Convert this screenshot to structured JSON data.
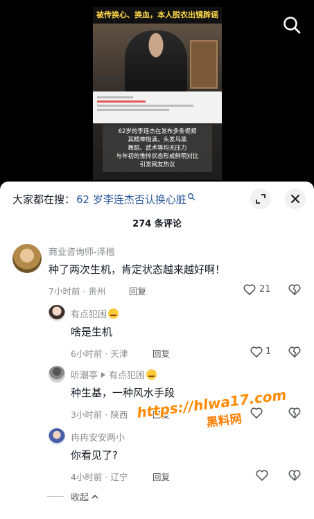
{
  "video": {
    "headline": "被传换心、换血，本人脱衣出镜辟谣",
    "caption_lines": [
      "62岁的李连杰在发布多条视频",
      "其精神饱满，头发乌黑",
      "舞蹈、武术等均无压力",
      "与年初的憔悴状态形成鲜明对比",
      "引发网友热议"
    ]
  },
  "header": {
    "search_prefix": "大家都在搜：",
    "search_suggestion": "62 岁李连杰否认换心脏",
    "comment_count": "274 条评论"
  },
  "comments": [
    {
      "author": "商业咨询师-泽楷",
      "text": "种了两次生机，肯定状态越来越好啊！",
      "time_location": "7小时前 · 贵州",
      "reply_label": "回复",
      "likes": "21"
    },
    {
      "author": "有点犯困",
      "text": "啥是生机",
      "time_location": "6小时前 · 天津",
      "reply_label": "回复",
      "likes": "1"
    },
    {
      "author": "听潮亭",
      "reply_to": "有点犯困",
      "text": "种生基，一种风水手段",
      "time_location": "3小时前 · 陕西",
      "reply_label": "回复",
      "likes": ""
    },
    {
      "author": "冉冉安安两小",
      "text": "你看见了?",
      "time_location": "4小时前 · 辽宁",
      "reply_label": "回复",
      "likes": ""
    }
  ],
  "collapse_label": "收起",
  "watermark": {
    "url": "https://hlwa17.com",
    "sub": "黑料网"
  },
  "colors": {
    "link": "#2b5a9e",
    "watermark": "#ff8a00",
    "meta_text": "#8a8b91"
  }
}
